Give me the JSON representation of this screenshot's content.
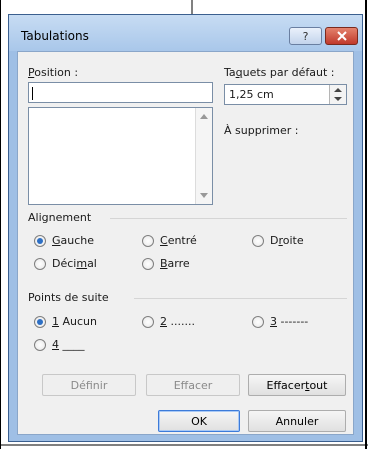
{
  "dialog": {
    "title": "Tabulations",
    "help_glyph": "?",
    "close_glyph": "x"
  },
  "position": {
    "label_pre": "",
    "label_u": "P",
    "label_post": "osition :",
    "value": ""
  },
  "default_tabs": {
    "label_pre": "Ta",
    "label_u": "q",
    "label_post": "uets par défaut :",
    "value": "1,25 cm"
  },
  "to_clear": {
    "label": "À supprimer :"
  },
  "alignment": {
    "title": "Alignement",
    "options": [
      {
        "pre": "",
        "u": "G",
        "post": "auche",
        "checked": true
      },
      {
        "pre": "",
        "u": "C",
        "post": "entré",
        "checked": false
      },
      {
        "pre": "D",
        "u": "r",
        "post": "oite",
        "checked": false
      },
      {
        "pre": "Déci",
        "u": "m",
        "post": "al",
        "checked": false
      },
      {
        "pre": "",
        "u": "B",
        "post": "arre",
        "checked": false
      }
    ]
  },
  "leader": {
    "title": "Points de suite",
    "options": [
      {
        "pre": "",
        "u": "1",
        "post": " Aucun",
        "checked": true
      },
      {
        "pre": "",
        "u": "2",
        "post": " .......",
        "checked": false
      },
      {
        "pre": "",
        "u": "3",
        "post": " -------",
        "checked": false
      },
      {
        "pre": "",
        "u": "4",
        "post": " ____",
        "checked": false
      }
    ]
  },
  "buttons": {
    "set": "Définir",
    "clear": "Effacer",
    "clear_all_pre": "Effacer ",
    "clear_all_u": "t",
    "clear_all_post": "out",
    "ok": "OK",
    "cancel": "Annuler"
  },
  "colors": {
    "frame": "#9fbfe5",
    "close": "#c0392b",
    "radio_dot": "#2d6fc4",
    "default_button_border": "#3d7bd9"
  }
}
